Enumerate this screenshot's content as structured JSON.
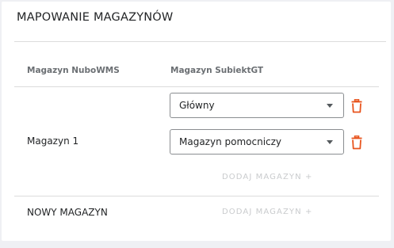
{
  "card": {
    "title": "MAPOWANIE MAGAZYNÓW"
  },
  "table": {
    "headers": {
      "wms": "Magazyn NuboWMS",
      "subiekt": "Magazyn SubiektGT"
    },
    "rows": [
      {
        "label": "Magazyn 1",
        "mappings": [
          {
            "selected": "Główny"
          },
          {
            "selected": "Magazyn pomocniczy"
          }
        ],
        "add_label": "DODAJ MAGAZYN +"
      },
      {
        "label": "NOWY MAGAZYN",
        "add_label": "DODAJ MAGAZYN +"
      }
    ]
  },
  "colors": {
    "delete_icon": "#e8541d",
    "add_link": "#c9cbcd",
    "divider": "#dcdcdc"
  },
  "icons": {
    "delete": "trash-icon",
    "dropdown": "chevron-down-icon"
  }
}
